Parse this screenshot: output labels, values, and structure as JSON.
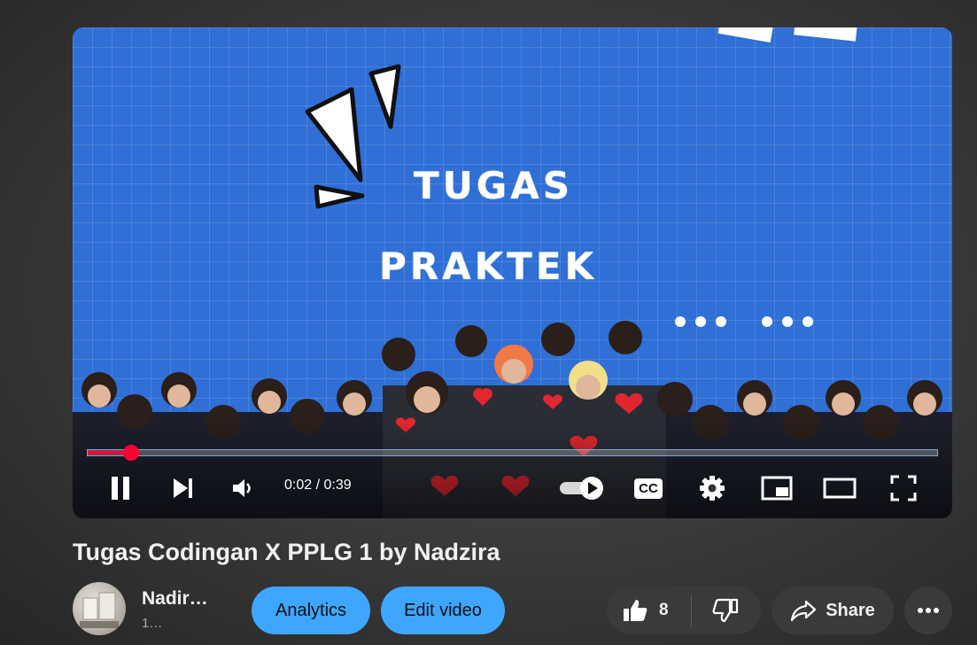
{
  "video": {
    "overlay_title_line1": "TUGAS",
    "overlay_title_line2": "PRAKTEK",
    "progress_fraction": 0.051
  },
  "controls": {
    "time_display": "0:02 / 0:39",
    "pause_icon": "pause-icon",
    "next_icon": "next-icon",
    "volume_icon": "volume-icon",
    "autoplay_icon": "autoplay-toggle-icon",
    "captions_label": "CC",
    "settings_icon": "gear-icon",
    "miniplayer_icon": "miniplayer-icon",
    "theater_icon": "theater-icon",
    "fullscreen_icon": "fullscreen-icon",
    "accent_color": "#ff0033"
  },
  "meta": {
    "title": "Tugas Codingan X PPLG 1 by Nadzira",
    "channel_name": "Nadir…",
    "channel_sub": "1…"
  },
  "actions": {
    "analytics_label": "Analytics",
    "edit_label": "Edit video",
    "like_count": "8",
    "share_label": "Share",
    "more_icon": "more-icon",
    "button_color": "#3ea6ff"
  }
}
